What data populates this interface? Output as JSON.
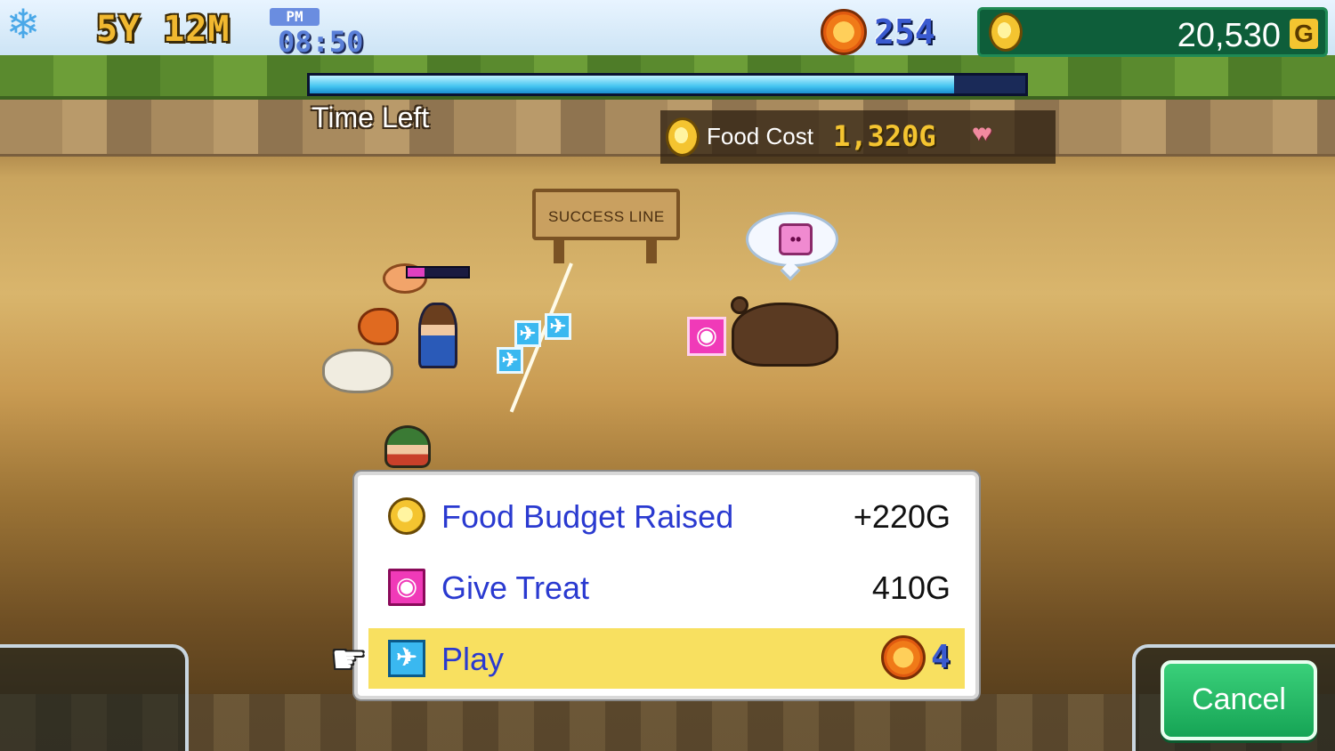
{
  "hud": {
    "season_icon": "snowflake-icon",
    "date": "5Y 12M",
    "ampm": "PM",
    "time": "08:50",
    "research_points": "254",
    "money": "20,530",
    "money_unit": "G"
  },
  "timer": {
    "label": "Time Left",
    "remaining_fraction": 0.9
  },
  "food_cost": {
    "label": "Food Cost",
    "value": "1,320G",
    "hearts_icon": "hearts-icon"
  },
  "field": {
    "sign_text": "SUCCESS LINE"
  },
  "menu": {
    "items": [
      {
        "label": "Food Budget Raised",
        "value": "+220G",
        "icon": "coin-icon"
      },
      {
        "label": "Give Treat",
        "value": "410G",
        "icon": "treat-icon"
      },
      {
        "label": "Play",
        "cost": "4",
        "icon": "play-icon",
        "cost_icon": "sun-medal-icon",
        "selected": true
      }
    ]
  },
  "buttons": {
    "cancel": "Cancel"
  },
  "colors": {
    "menu_label": "#2a3ad0",
    "selected_row": "#f8e060",
    "money_panel": "#0e5e3a",
    "cancel_button": "#16a455"
  }
}
